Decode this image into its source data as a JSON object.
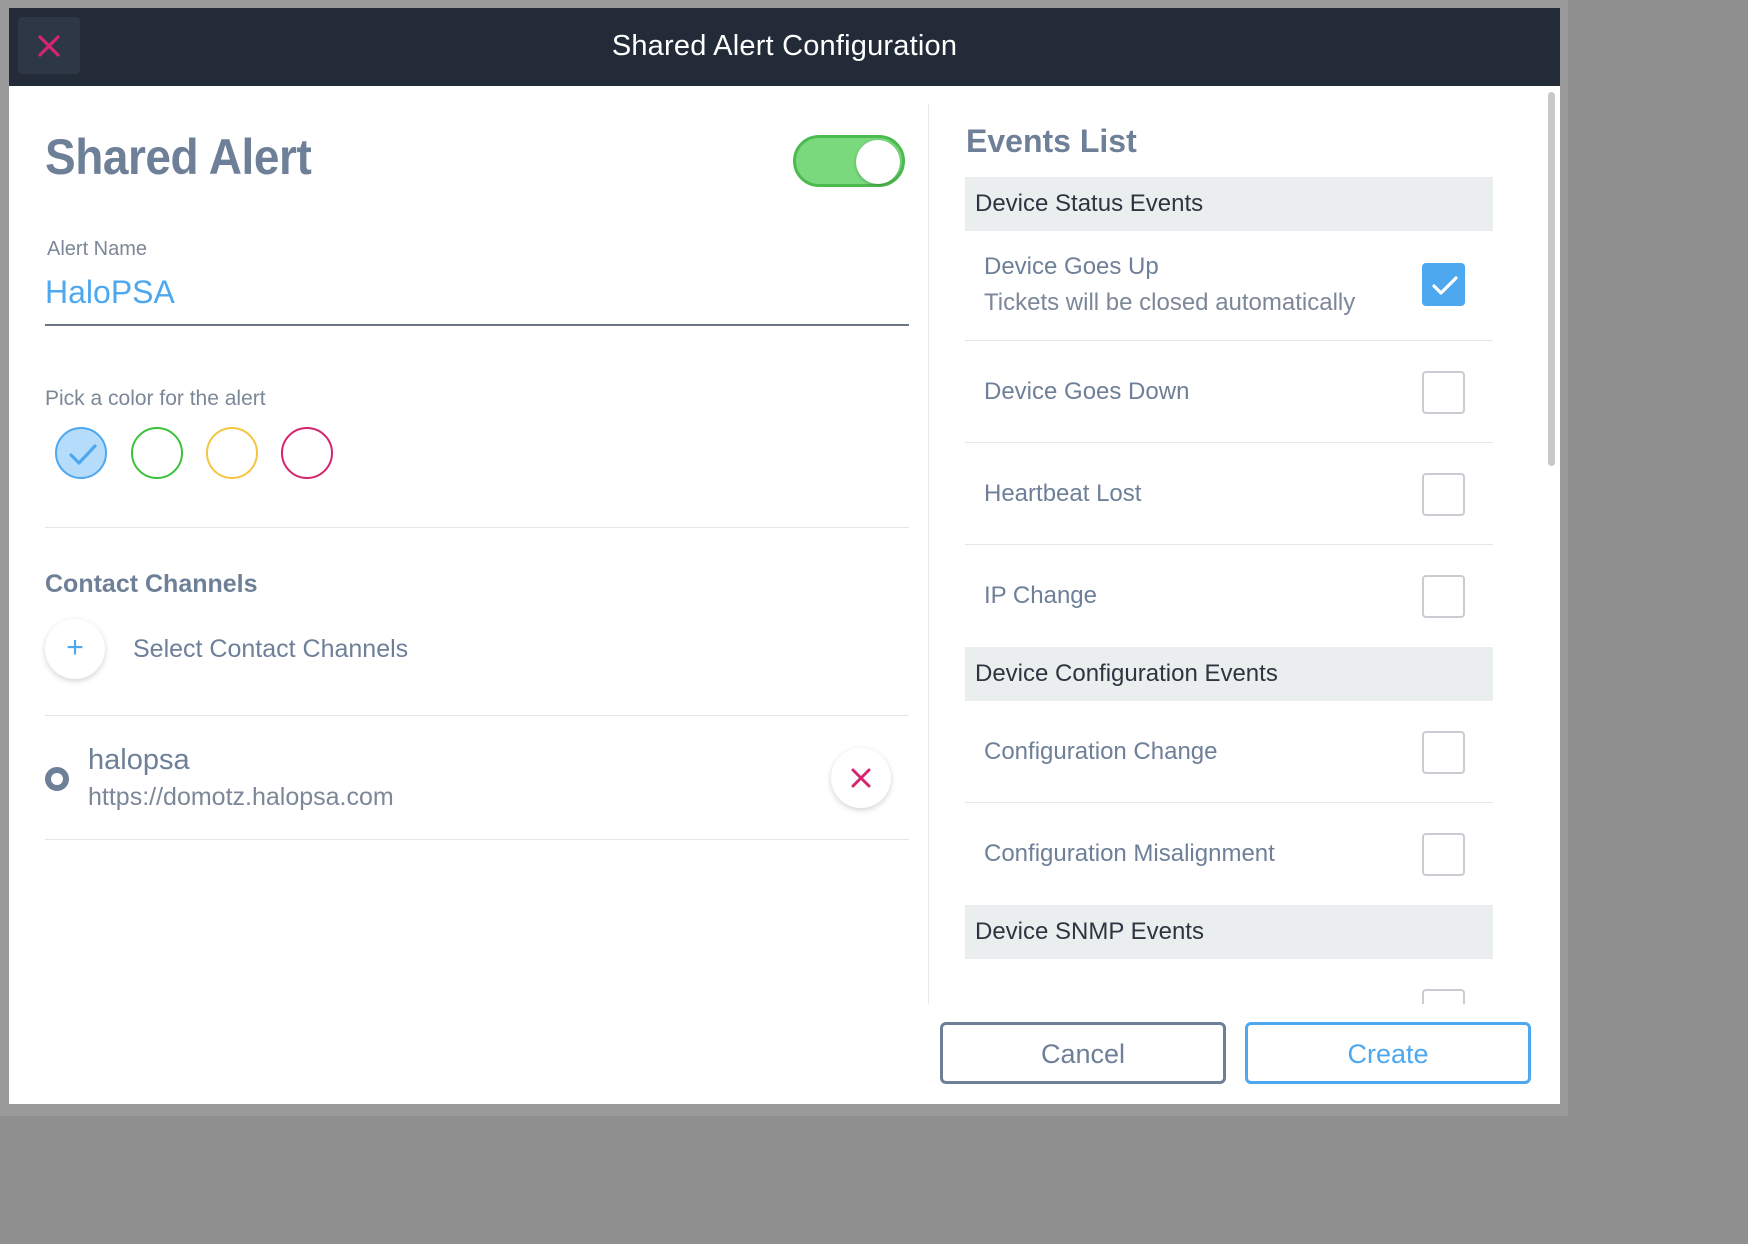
{
  "modal": {
    "title": "Shared Alert Configuration",
    "close_icon": "close-icon",
    "accent_color": "#4ea8f0",
    "danger_color": "#d6246e",
    "header_bg": "#222b37"
  },
  "alert": {
    "heading": "Shared Alert",
    "enabled": true,
    "name_label": "Alert Name",
    "name_value": "HaloPSA",
    "color_label": "Pick a color for the alert",
    "colors": [
      {
        "name": "blue",
        "hex": "#4ea8f0",
        "selected": true
      },
      {
        "name": "green",
        "hex": "#3cc13b",
        "selected": false
      },
      {
        "name": "yellow",
        "hex": "#f5c542",
        "selected": false
      },
      {
        "name": "red",
        "hex": "#d6246e",
        "selected": false
      }
    ]
  },
  "contact_channels": {
    "heading": "Contact Channels",
    "add_label": "Select Contact Channels",
    "add_icon": "plus-icon",
    "items": [
      {
        "name": "halopsa",
        "url": "https://domotz.halopsa.com",
        "remove_icon": "close-icon"
      }
    ]
  },
  "events": {
    "heading": "Events List",
    "groups": [
      {
        "title": "Device Status Events",
        "items": [
          {
            "label": "Device Goes Up",
            "note": "Tickets will be closed automatically",
            "checked": true
          },
          {
            "label": "Device Goes Down",
            "checked": false
          },
          {
            "label": "Heartbeat Lost",
            "checked": false
          },
          {
            "label": "IP Change",
            "checked": false
          }
        ]
      },
      {
        "title": "Device Configuration Events",
        "items": [
          {
            "label": "Configuration Change",
            "checked": false
          },
          {
            "label": "Configuration Misalignment",
            "checked": false
          }
        ]
      },
      {
        "title": "Device SNMP Events",
        "items": []
      }
    ]
  },
  "footer": {
    "cancel_label": "Cancel",
    "create_label": "Create"
  }
}
